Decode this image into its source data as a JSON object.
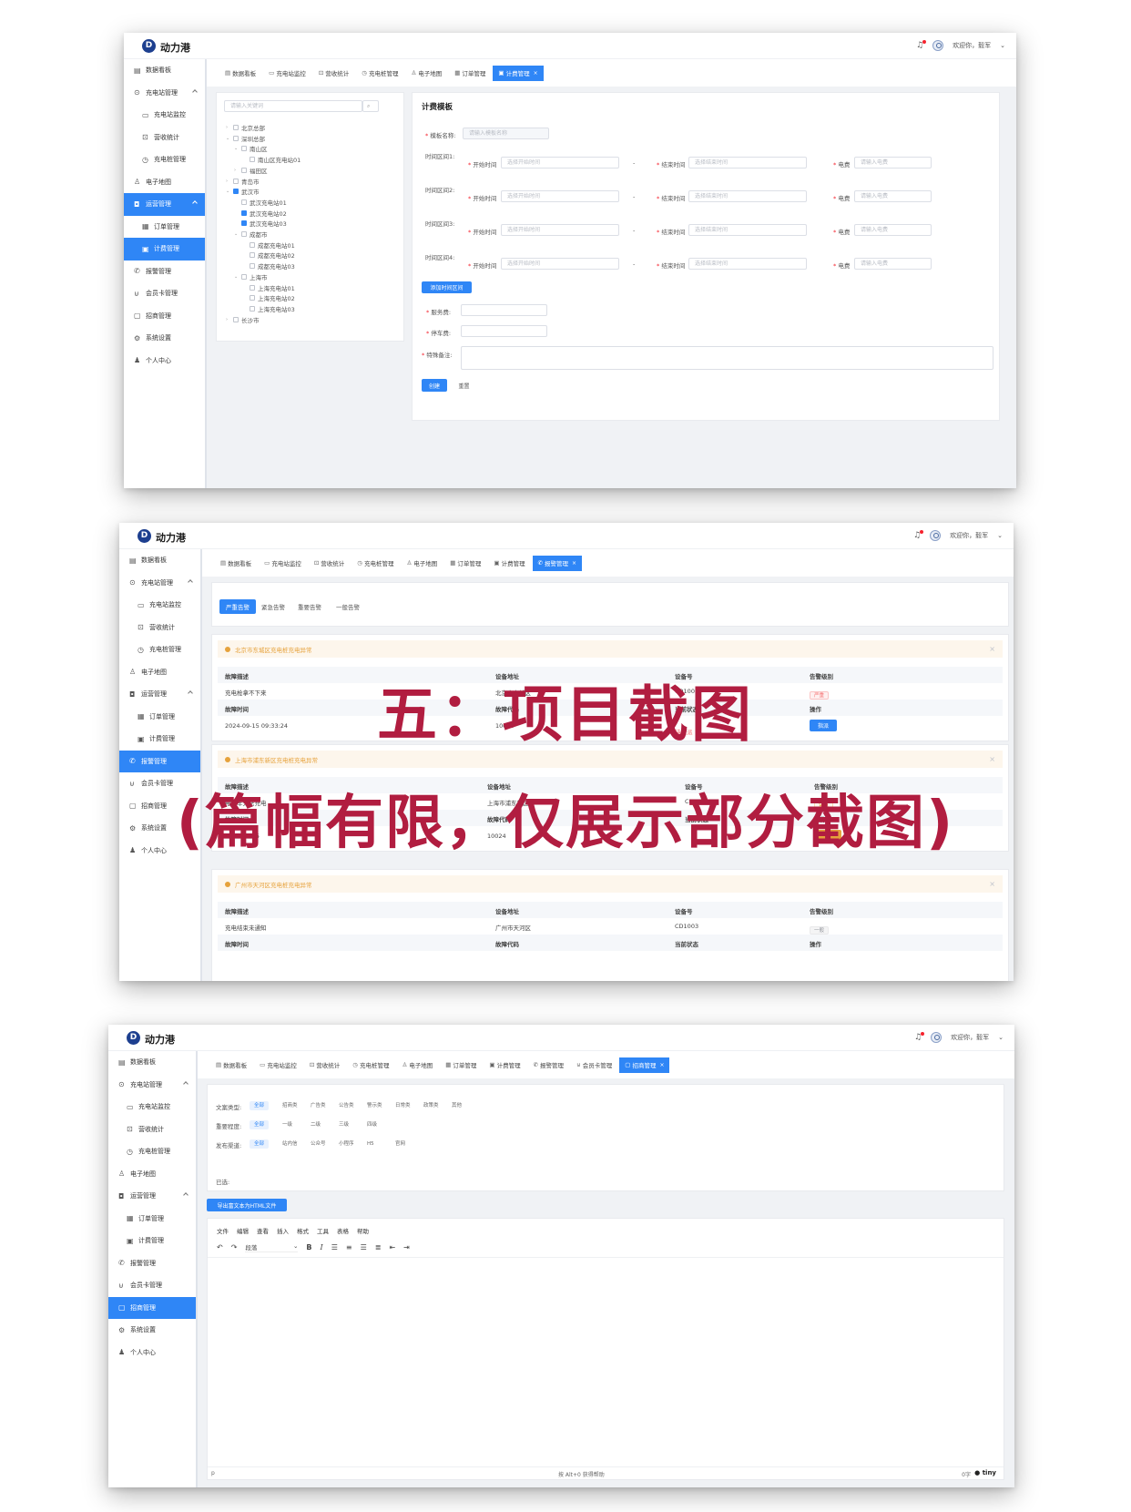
{
  "brand": "动力港",
  "header": {
    "welcome": "欢迎你，毅军"
  },
  "overlay": {
    "line1": "五：项目截图",
    "line2": "(篇幅有限，仅展示部分截图)"
  },
  "menu": {
    "dashboard": "数据看板",
    "station_mgmt": "充电站管理",
    "station_monitor": "充电站监控",
    "revenue": "营收统计",
    "pile_mgmt": "充电桩管理",
    "map": "电子地图",
    "ops_mgmt": "运营管理",
    "order_mgmt": "订单管理",
    "billing_mgmt": "计费管理",
    "alarm_mgmt": "报警管理",
    "member_mgmt": "会员卡管理",
    "merchant_mgmt": "招商管理",
    "settings": "系统设置",
    "profile": "个人中心"
  },
  "tabs": {
    "dashboard": "数据看板",
    "station_monitor": "充电站监控",
    "revenue": "营收统计",
    "pile_mgmt": "充电桩管理",
    "map": "电子地图",
    "order_mgmt": "订单管理",
    "billing_mgmt": "计费管理",
    "alarm_mgmt": "报警管理",
    "member_mgmt": "会员卡管理",
    "merchant_mgmt": "招商管理",
    "close": "×"
  },
  "s1": {
    "search_placeholder": "请输入关键词",
    "tree": [
      {
        "label": "北京总部",
        "toggle": "›",
        "check": false
      },
      {
        "label": "深圳总部",
        "toggle": "⌄",
        "check": false
      },
      {
        "label": "南山区",
        "toggle": "⌄",
        "check": false
      },
      {
        "label": "南山区充电站01",
        "toggle": "",
        "check": false
      },
      {
        "label": "福田区",
        "toggle": "›",
        "check": false
      },
      {
        "label": "青岛市",
        "toggle": "›",
        "check": false
      },
      {
        "label": "武汉市",
        "toggle": "⌄",
        "check": true
      },
      {
        "label": "武汉充电站01",
        "toggle": "",
        "check": false
      },
      {
        "label": "武汉充电站02",
        "toggle": "",
        "check": true
      },
      {
        "label": "武汉充电站03",
        "toggle": "",
        "check": true
      },
      {
        "label": "成都市",
        "toggle": "⌄",
        "check": false
      },
      {
        "label": "成都充电站01",
        "toggle": "",
        "check": false
      },
      {
        "label": "成都充电站02",
        "toggle": "",
        "check": false
      },
      {
        "label": "成都充电站03",
        "toggle": "",
        "check": false
      },
      {
        "label": "上海市",
        "toggle": "⌄",
        "check": false
      },
      {
        "label": "上海充电站01",
        "toggle": "",
        "check": false
      },
      {
        "label": "上海充电站02",
        "toggle": "",
        "check": false
      },
      {
        "label": "上海充电站03",
        "toggle": "",
        "check": false
      },
      {
        "label": "长沙市",
        "toggle": "›",
        "check": false
      }
    ],
    "form_title": "计费模板",
    "template_name_label": "模板名称:",
    "template_name_placeholder": "请输入模板名称",
    "periods": [
      "时间区间1:",
      "时间区间2:",
      "时间区间3:",
      "时间区间4:"
    ],
    "start_label": "开始时间",
    "start_placeholder": "选择开始时间",
    "end_label": "结束时间",
    "end_placeholder": "选择结束时间",
    "fee_label": "电费",
    "fee_placeholder": "请输入电费",
    "add_period": "添加时间区间",
    "service_fee": "服务费:",
    "parking_fee": "停车费:",
    "remark": "特殊备注:",
    "create": "创建",
    "reset": "重置"
  },
  "s2": {
    "subtabs": [
      "严重告警",
      "紧急告警",
      "重要告警",
      "一般告警"
    ],
    "cards": [
      {
        "title": "北京市东城区充电桩充电异常",
        "h1": [
          "故障描述",
          "设备地址",
          "设备号",
          "告警级别"
        ],
        "r1": [
          "充电枪拿不下来",
          "北京市东城区",
          "CD1001",
          "严重"
        ],
        "h2": [
          "故障时间",
          "故障代码",
          "当前状态",
          "操作"
        ],
        "r2": [
          "2024-09-15 09:33:24",
          "10023",
          "待指派",
          "指派"
        ]
      },
      {
        "title": "上海市浦东新区充电桩充电异常",
        "h1": [
          "故障描述",
          "设备地址",
          "设备号",
          "告警级别"
        ],
        "r1": [
          "电动车无法充电",
          "上海市浦东新区",
          "CD1002",
          "紧急"
        ],
        "h2": [
          "故障时间",
          "故障代码",
          "当前状态",
          "操作"
        ],
        "r2": [
          "2024-09-16",
          "10024",
          "",
          ""
        ]
      },
      {
        "title": "广州市天河区充电桩充电异常",
        "h1": [
          "故障描述",
          "设备地址",
          "设备号",
          "告警级别"
        ],
        "r1": [
          "充电结束未通知",
          "广州市天河区",
          "CD1003",
          "一般"
        ],
        "h2": [
          "故障时间",
          "故障代码",
          "当前状态",
          "操作"
        ]
      }
    ]
  },
  "s3": {
    "filters": [
      {
        "label": "文案类型:",
        "options": [
          "全部",
          "招商类",
          "广告类",
          "公告类",
          "警示类",
          "日常类",
          "政策类",
          "其他"
        ]
      },
      {
        "label": "重要程度:",
        "options": [
          "全部",
          "一级",
          "二级",
          "三级",
          "四级"
        ]
      },
      {
        "label": "发布渠道:",
        "options": [
          "全部",
          "站内信",
          "公众号",
          "小程序",
          "H5",
          "官网"
        ]
      }
    ],
    "selected_label": "已选:",
    "export_btn": "导出富文本为HTML文件",
    "editor_menu": [
      "文件",
      "编辑",
      "查看",
      "插入",
      "格式",
      "工具",
      "表格",
      "帮助"
    ],
    "paragraph": "段落",
    "status_left": "p",
    "status_mid": "按 Alt+0 获得帮助",
    "status_right": "0字",
    "tiny": "tiny"
  }
}
